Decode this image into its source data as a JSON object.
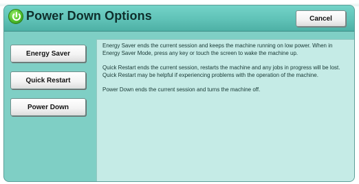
{
  "header": {
    "title": "Power Down Options",
    "cancel_label": "Cancel"
  },
  "options": [
    {
      "label": "Energy Saver"
    },
    {
      "label": "Quick Restart"
    },
    {
      "label": "Power Down"
    }
  ],
  "descriptions": [
    "Energy Saver ends the current session and keeps the machine running on low power. When in Energy Saver Mode, press any key or touch the screen to wake the machine up.",
    "Quick Restart ends the current session, restarts the machine and any jobs in progress will be lost. Quick Restart may be helpful if experiencing problems with the operation of the machine.",
    "Power Down ends the current session and turns the machine off."
  ],
  "icons": {
    "header_icon": "power-icon"
  },
  "colors": {
    "panel_background": "#7fcfc5",
    "header_background": "#5fc2b7",
    "content_background": "#c5ebe6",
    "power_icon": "#4fbe2a"
  }
}
